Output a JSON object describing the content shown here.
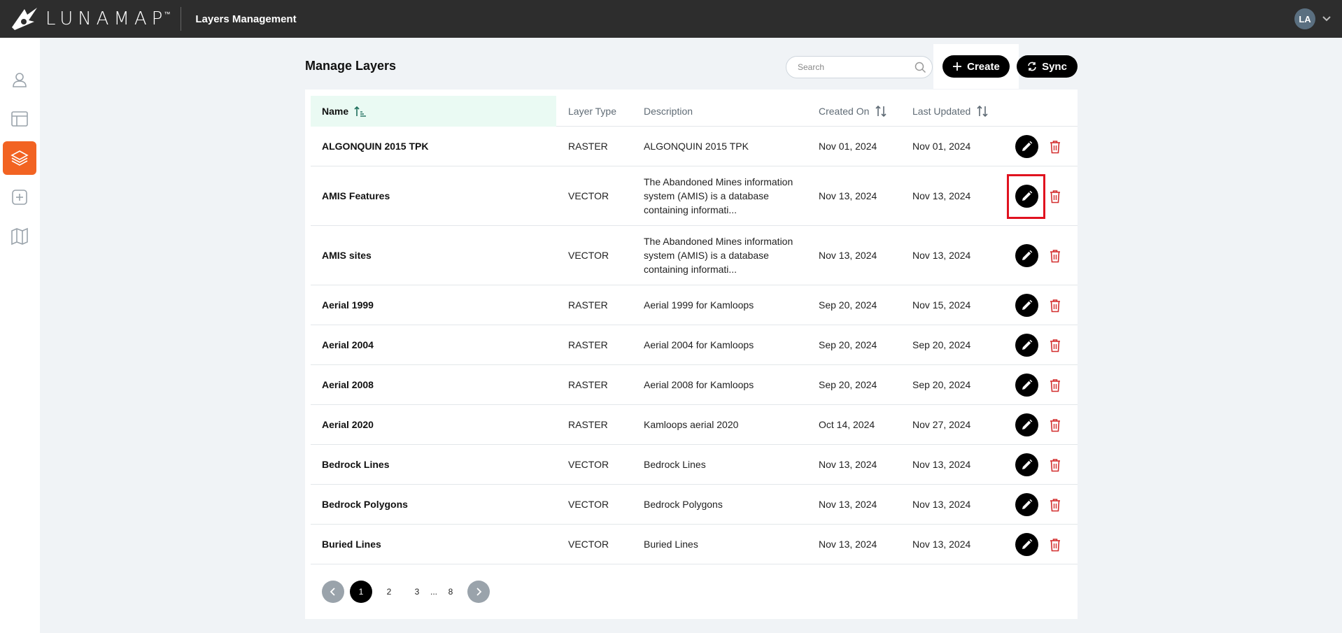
{
  "app": {
    "brand": "LUNAMAP",
    "trademark": "™",
    "section_title": "Layers Management",
    "user_initials": "LA"
  },
  "sidebar": {
    "items": [
      {
        "icon": "user-icon",
        "active": false
      },
      {
        "icon": "layout-icon",
        "active": false
      },
      {
        "icon": "layers-icon",
        "active": true
      },
      {
        "icon": "add-box-icon",
        "active": false
      },
      {
        "icon": "map-icon",
        "active": false
      }
    ]
  },
  "header": {
    "title": "Manage Layers",
    "search_placeholder": "Search",
    "search_value": "",
    "create_label": "Create",
    "sync_label": "Sync"
  },
  "table": {
    "columns": {
      "name": "Name",
      "type": "Layer Type",
      "description": "Description",
      "created": "Created On",
      "updated": "Last Updated"
    },
    "sort": {
      "column": "name",
      "direction": "asc"
    },
    "rows": [
      {
        "name": "ALGONQUIN 2015 TPK",
        "type": "RASTER",
        "description": "ALGONQUIN 2015 TPK",
        "created": "Nov 01, 2024",
        "updated": "Nov 01, 2024"
      },
      {
        "name": "AMIS Features",
        "type": "VECTOR",
        "description": "The Abandoned Mines information system (AMIS) is a database containing informati...",
        "created": "Nov 13, 2024",
        "updated": "Nov 13, 2024"
      },
      {
        "name": "AMIS sites",
        "type": "VECTOR",
        "description": "The Abandoned Mines information system (AMIS) is a database containing informati...",
        "created": "Nov 13, 2024",
        "updated": "Nov 13, 2024"
      },
      {
        "name": "Aerial 1999",
        "type": "RASTER",
        "description": "Aerial 1999 for Kamloops",
        "created": "Sep 20, 2024",
        "updated": "Nov 15, 2024"
      },
      {
        "name": "Aerial 2004",
        "type": "RASTER",
        "description": "Aerial 2004 for Kamloops",
        "created": "Sep 20, 2024",
        "updated": "Sep 20, 2024"
      },
      {
        "name": "Aerial 2008",
        "type": "RASTER",
        "description": "Aerial 2008 for Kamloops",
        "created": "Sep 20, 2024",
        "updated": "Sep 20, 2024"
      },
      {
        "name": "Aerial 2020",
        "type": "RASTER",
        "description": "Kamloops aerial 2020",
        "created": "Oct 14, 2024",
        "updated": "Nov 27, 2024"
      },
      {
        "name": "Bedrock Lines",
        "type": "VECTOR",
        "description": "Bedrock Lines",
        "created": "Nov 13, 2024",
        "updated": "Nov 13, 2024"
      },
      {
        "name": "Bedrock Polygons",
        "type": "VECTOR",
        "description": "Bedrock Polygons",
        "created": "Nov 13, 2024",
        "updated": "Nov 13, 2024"
      },
      {
        "name": "Buried Lines",
        "type": "VECTOR",
        "description": "Buried Lines",
        "created": "Nov 13, 2024",
        "updated": "Nov 13, 2024"
      }
    ]
  },
  "pagination": {
    "pages": [
      "1",
      "2",
      "3"
    ],
    "ellipsis": "...",
    "last_page": "8",
    "current": "1"
  },
  "colors": {
    "topbar": "#2d2d2d",
    "accent": "#f26322",
    "delete": "#d32f2f",
    "sorted_header": "#eafaf3",
    "highlight": "#e0121f"
  }
}
